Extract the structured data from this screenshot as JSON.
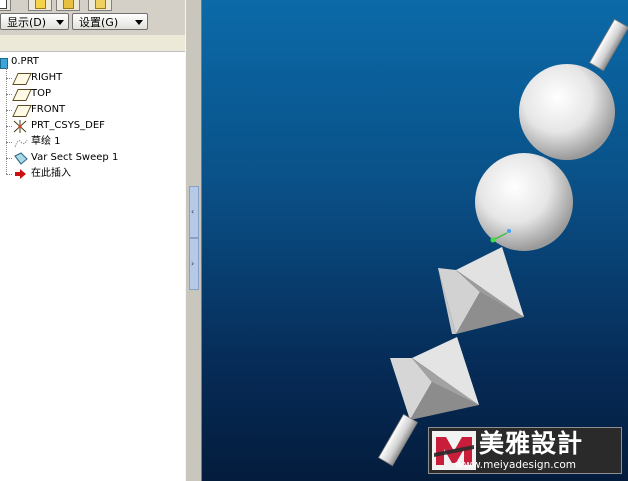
{
  "toolbar": {
    "show_label": "显示(D)",
    "settings_label": "设置(G)"
  },
  "tree": {
    "root": "0.PRT",
    "items": [
      {
        "label": "RIGHT",
        "icon": "datum-plane-icon"
      },
      {
        "label": "TOP",
        "icon": "datum-plane-icon"
      },
      {
        "label": "FRONT",
        "icon": "datum-plane-icon"
      },
      {
        "label": "PRT_CSYS_DEF",
        "icon": "coordinate-system-icon"
      },
      {
        "label": "草绘 1",
        "icon": "sketch-icon"
      },
      {
        "label": "Var Sect Sweep 1",
        "icon": "sweep-feature-icon"
      },
      {
        "label": "在此插入",
        "icon": "insert-here-arrow-icon"
      }
    ]
  },
  "watermark": {
    "brand": "美雅設計",
    "url": "www.meiyadesign.com"
  },
  "colors": {
    "viewport_top": "#0b6aa8",
    "viewport_bottom": "#041c3c",
    "insert_arrow": "#cc1010",
    "logo_accent": "#c81e3c"
  }
}
